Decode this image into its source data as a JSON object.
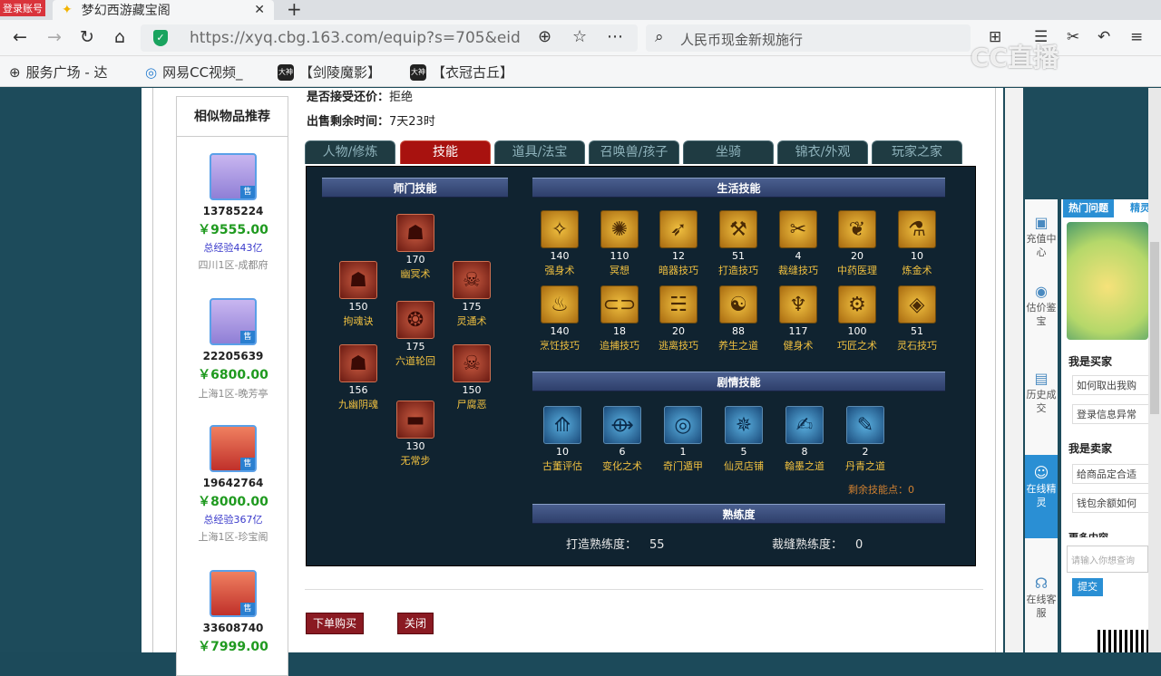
{
  "browser": {
    "login_badge": "登录账号",
    "tab_title": "梦幻西游藏宝阁",
    "url": "https://xyq.cbg.163.com/equip?s=705&eid",
    "search_text": "人民币现金新规施行",
    "watermark": "CC直播"
  },
  "bookmarks": [
    {
      "label": "服务广场 - 达"
    },
    {
      "label": "网易CC视频_"
    },
    {
      "label": "【剑陵魔影】"
    },
    {
      "label": "【衣冠古丘】"
    }
  ],
  "sidebar": {
    "title": "相似物品推荐",
    "items": [
      {
        "id": "13785224",
        "price": "￥9555.00",
        "exp": "总经验443亿",
        "server": "四川1区-成都府",
        "badge": "售"
      },
      {
        "id": "22205639",
        "price": "￥6800.00",
        "exp": "",
        "server": "上海1区-晚芳亭",
        "badge": "售"
      },
      {
        "id": "19642764",
        "price": "￥8000.00",
        "exp": "总经验367亿",
        "server": "上海1区-珍宝阁",
        "badge": "售"
      },
      {
        "id": "33608740",
        "price": "￥7999.00",
        "exp": "",
        "server": "",
        "badge": "售"
      }
    ]
  },
  "info": {
    "counter_label": "是否接受还价：",
    "counter_value": "拒绝",
    "remain_label": "出售剩余时间：",
    "remain_value": "7天23时"
  },
  "tabs": [
    "人物/修炼",
    "技能",
    "道具/法宝",
    "召唤兽/孩子",
    "坐骑",
    "锦衣/外观",
    "玩家之家"
  ],
  "active_tab": "技能",
  "sections": {
    "school": "师门技能",
    "life": "生活技能",
    "story": "剧情技能",
    "proficiency": "熟练度"
  },
  "school_skills": [
    {
      "name": "幽冥术",
      "level": "170"
    },
    {
      "name": "拘魂诀",
      "level": "150"
    },
    {
      "name": "六道轮回",
      "level": "175"
    },
    {
      "name": "灵通术",
      "level": "175"
    },
    {
      "name": "九幽阴魂",
      "level": "156"
    },
    {
      "name": "尸腐恶",
      "level": "150"
    },
    {
      "name": "无常步",
      "level": "130"
    }
  ],
  "life_skills": [
    {
      "name": "强身术",
      "level": "140"
    },
    {
      "name": "冥想",
      "level": "110"
    },
    {
      "name": "暗器技巧",
      "level": "12"
    },
    {
      "name": "打造技巧",
      "level": "51"
    },
    {
      "name": "裁缝技巧",
      "level": "4"
    },
    {
      "name": "中药医理",
      "level": "20"
    },
    {
      "name": "炼金术",
      "level": "10"
    },
    {
      "name": "烹饪技巧",
      "level": "140"
    },
    {
      "name": "追捕技巧",
      "level": "18"
    },
    {
      "name": "逃离技巧",
      "level": "20"
    },
    {
      "name": "养生之道",
      "level": "88"
    },
    {
      "name": "健身术",
      "level": "117"
    },
    {
      "name": "巧匠之术",
      "level": "100"
    },
    {
      "name": "灵石技巧",
      "level": "51"
    }
  ],
  "story_skills": [
    {
      "name": "古董评估",
      "level": "10"
    },
    {
      "name": "变化之术",
      "level": "6"
    },
    {
      "name": "奇门遁甲",
      "level": "1"
    },
    {
      "name": "仙灵店铺",
      "level": "5"
    },
    {
      "name": "翰墨之道",
      "level": "8"
    },
    {
      "name": "丹青之道",
      "level": "2"
    }
  ],
  "remaining_points": "剩余技能点：0",
  "proficiency": {
    "forge_label": "打造熟练度：",
    "forge_value": "55",
    "tailor_label": "裁缝熟练度：",
    "tailor_value": "0"
  },
  "buttons": {
    "buy": "下单购买",
    "close": "关闭"
  },
  "right_nav": [
    {
      "label": "充值中心",
      "icon": "wallet-icon"
    },
    {
      "label": "估价鉴宝",
      "icon": "appraise-icon"
    },
    {
      "label": "历史成交",
      "icon": "history-icon"
    },
    {
      "label": "在线精灵",
      "icon": "sprite-icon"
    },
    {
      "label": "在线客服",
      "icon": "headset-icon"
    }
  ],
  "help": {
    "tab_hot": "热门问题",
    "tab_other": "精灵",
    "buyer_title": "我是买家",
    "buyer_q1": "如何取出我购",
    "buyer_q2": "登录信息异常",
    "seller_title": "我是卖家",
    "seller_q1": "给商品定合适",
    "seller_q2": "钱包余额如何",
    "more": "更多内容",
    "input_placeholder": "请输入你想查询",
    "submit": "提交"
  },
  "colors": {
    "accent_red": "#a8120f",
    "price_green": "#1f9a1f",
    "panel_bg": "#102330",
    "link_blue": "#2a8fd4"
  }
}
